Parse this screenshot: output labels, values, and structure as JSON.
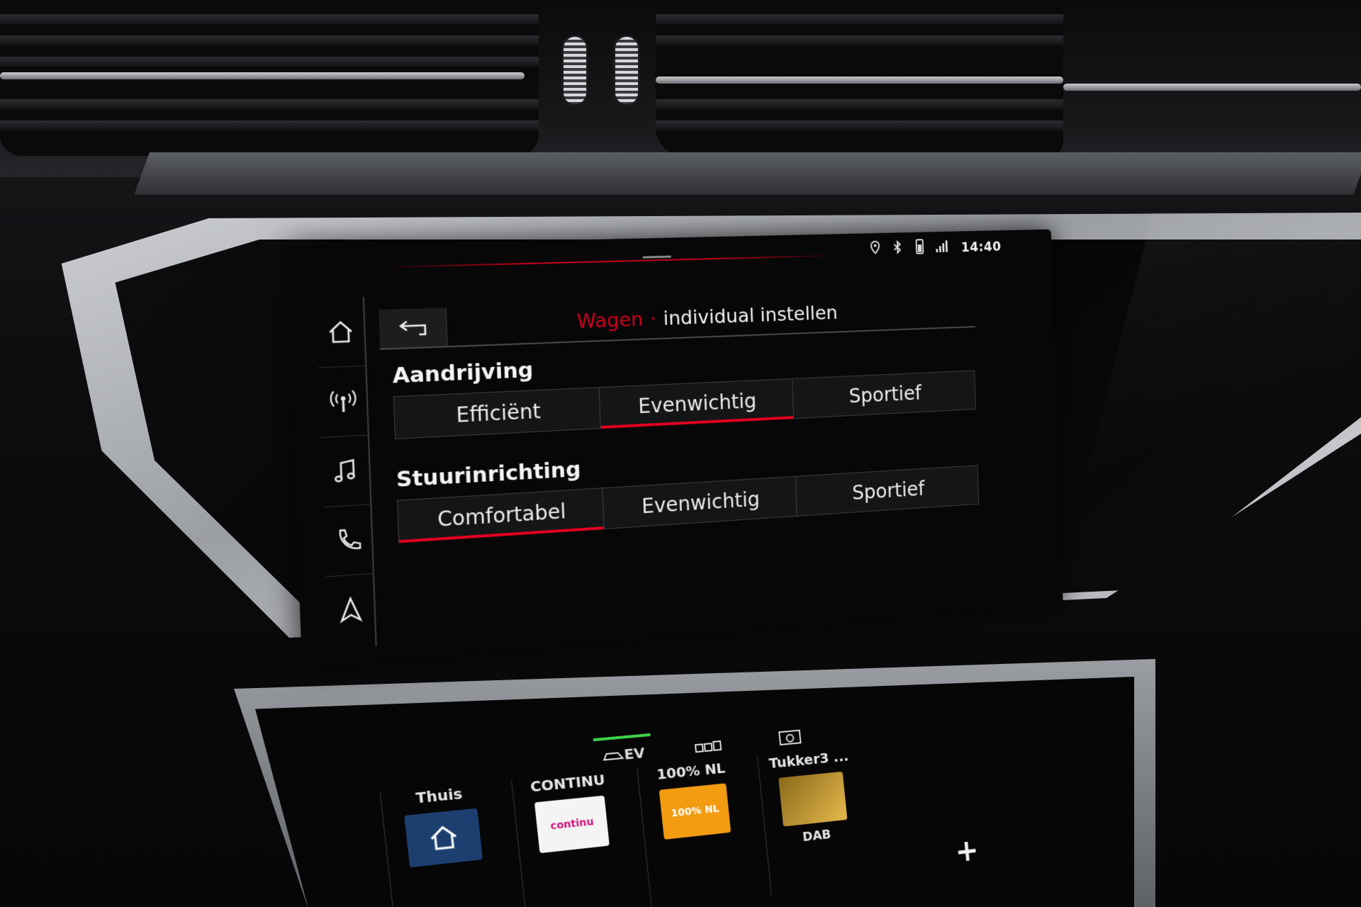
{
  "status_bar": {
    "clock": "14:40",
    "icons": [
      "location-icon",
      "bluetooth-icon",
      "phone-battery-icon",
      "signal-icon"
    ]
  },
  "sidebar": {
    "items": [
      {
        "icon": "home-icon"
      },
      {
        "icon": "radio-icon"
      },
      {
        "icon": "music-icon"
      },
      {
        "icon": "phone-icon"
      },
      {
        "icon": "navigation-icon"
      }
    ]
  },
  "header": {
    "breadcrumb_root": "Wagen",
    "breadcrumb_separator": "·",
    "breadcrumb_leaf": "individual instellen"
  },
  "sections": {
    "drive": {
      "title": "Aandrijving",
      "options": [
        "Efficiënt",
        "Evenwichtig",
        "Sportief"
      ],
      "selected": "Evenwichtig"
    },
    "steering": {
      "title": "Stuurinrichting",
      "options": [
        "Comfortabel",
        "Evenwichtig",
        "Sportief"
      ],
      "selected": "Comfortabel"
    }
  },
  "lower_screen": {
    "modes": [
      {
        "label": "EV",
        "active": true
      },
      {
        "label": "",
        "active": false
      },
      {
        "label": "",
        "active": false
      }
    ],
    "tiles": [
      {
        "label": "Thuis",
        "logo": "",
        "sub": ""
      },
      {
        "label": "CONTINU",
        "logo": "continu",
        "sub": ""
      },
      {
        "label": "100% NL",
        "logo": "100% NL",
        "sub": ""
      },
      {
        "label": "Tukker3 ...",
        "logo": "",
        "sub": "DAB"
      }
    ],
    "plus_label": "+"
  },
  "colors": {
    "accent_red": "#e2001f",
    "ev_green": "#3ed14a",
    "text": "#ececec"
  }
}
